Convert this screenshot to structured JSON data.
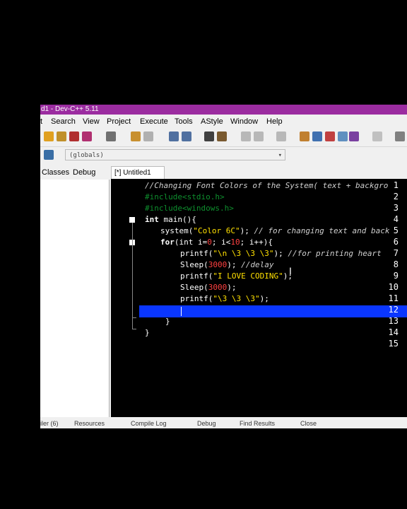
{
  "window": {
    "title": "d1 - Dev-C++ 5.11"
  },
  "menu": [
    "t",
    "Search",
    "View",
    "Project",
    "Execute",
    "Tools",
    "AStyle",
    "Window",
    "Help"
  ],
  "toolbar": {
    "scope_value": "(globals)"
  },
  "left_tabs": [
    "Classes",
    "Debug"
  ],
  "editor_tab": "[*] Untitled1",
  "line_numbers": [
    "1",
    "2",
    "3",
    "4",
    "5",
    "6",
    "7",
    "8",
    "9",
    "10",
    "11",
    "12",
    "13",
    "14",
    "15"
  ],
  "code": {
    "l1": "//Changing Font Colors of the System( text + backgro",
    "l2": "#include<stdio.h>",
    "l3": "#include<windows.h>",
    "l4_kw": "int",
    "l4_rest": " main(){",
    "l5_fn": "system(",
    "l5_str": "\"Color 6C\"",
    "l5_end": ");",
    "l5_comment": " // for changing text and back",
    "l6_kw": "for",
    "l6_a": "(int i=",
    "l6_n0": "0",
    "l6_b": "; i<",
    "l6_n10": "10",
    "l6_c": "; i++){",
    "l7_fn": "printf(",
    "l7_str": "\"\\n \\3 \\3 \\3\"",
    "l7_end": ");",
    "l7_comment": " //for printing heart",
    "l8_fn": "Sleep(",
    "l8_num": "3000",
    "l8_end": ");",
    "l8_comment": " //delay",
    "l9_fn": "printf(",
    "l9_str": "\"I LOVE CODING\"",
    "l9_end": ");",
    "l10_fn": "Sleep(",
    "l10_num": "3000",
    "l10_end": ");",
    "l11_fn": "printf(",
    "l11_str": "\"\\3 \\3 \\3\"",
    "l11_end": ");",
    "l13": "}",
    "l14": "}"
  },
  "status_tabs": [
    "iler (6)",
    "Resources",
    "Compile Log",
    "Debug",
    "Find Results",
    "Close"
  ],
  "colors": {
    "titlebar": "#9b2ca0",
    "current_line": "#0a36ff",
    "editor_bg": "#000000"
  }
}
